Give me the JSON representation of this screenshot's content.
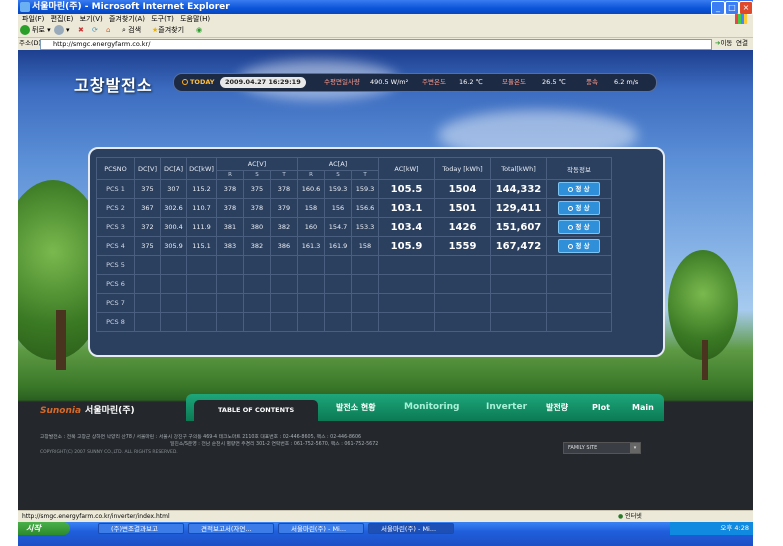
{
  "window": {
    "title": "서울마린(주) - Microsoft Internet Explorer",
    "min": "_",
    "max": "□",
    "close": "×"
  },
  "menu": [
    "파일(F)",
    "편집(E)",
    "보기(V)",
    "즐겨찾기(A)",
    "도구(T)",
    "도움말(H)"
  ],
  "toolbar": {
    "back": "뒤로",
    "search": "검색",
    "favorites": "즐겨찾기"
  },
  "address": {
    "label": "주소(D)",
    "url": "http://smgc.energyfarm.co.kr/",
    "go": "이동",
    "links": "연결 »"
  },
  "site": {
    "logo": "고창발전소",
    "today_label": "TODAY",
    "datetime": "2009.04.27 16:29:19",
    "irradiance_label": "수평면일사량",
    "irradiance_value": "490.5 W/m²",
    "ambient_label": "주변온도",
    "ambient_value": "16.2 ℃",
    "module_label": "모듈온도",
    "module_value": "26.5 ℃",
    "wind_label": "풍속",
    "wind_value": "6.2 m/s"
  },
  "table": {
    "headers": {
      "pcsno": "PCSNO",
      "dcv": "DC[V]",
      "dca": "DC[A]",
      "dckw": "DC[kW]",
      "acv": "AC[V]",
      "aca": "AC[A]",
      "ackw": "AC[kW]",
      "today": "Today [kWh]",
      "total": "Total[kWh]",
      "status": "작동정보",
      "r": "R",
      "s": "S",
      "t": "T"
    },
    "rows": [
      {
        "pcs": "PCS 1",
        "dcv": "375",
        "dca": "307",
        "dckw": "115.2",
        "acv_r": "378",
        "acv_s": "375",
        "acv_t": "378",
        "aca_r": "160.6",
        "aca_s": "159.3",
        "aca_t": "159.3",
        "ackw": "105.5",
        "today": "1504",
        "total": "144,332",
        "status": "정 상"
      },
      {
        "pcs": "PCS 2",
        "dcv": "367",
        "dca": "302.6",
        "dckw": "110.7",
        "acv_r": "378",
        "acv_s": "378",
        "acv_t": "379",
        "aca_r": "158",
        "aca_s": "156",
        "aca_t": "156.6",
        "ackw": "103.1",
        "today": "1501",
        "total": "129,411",
        "status": "정 상"
      },
      {
        "pcs": "PCS 3",
        "dcv": "372",
        "dca": "300.4",
        "dckw": "111.9",
        "acv_r": "381",
        "acv_s": "380",
        "acv_t": "382",
        "aca_r": "160",
        "aca_s": "154.7",
        "aca_t": "153.3",
        "ackw": "103.4",
        "today": "1426",
        "total": "151,607",
        "status": "정 상"
      },
      {
        "pcs": "PCS 4",
        "dcv": "375",
        "dca": "305.9",
        "dckw": "115.1",
        "acv_r": "383",
        "acv_s": "382",
        "acv_t": "386",
        "aca_r": "161.3",
        "aca_s": "161.9",
        "aca_t": "158",
        "ackw": "105.9",
        "today": "1559",
        "total": "167,472",
        "status": "정 상"
      },
      {
        "pcs": "PCS 5"
      },
      {
        "pcs": "PCS 6"
      },
      {
        "pcs": "PCS 7"
      },
      {
        "pcs": "PCS 8"
      }
    ]
  },
  "brand": {
    "mark": "Sunonia",
    "name": "서울마린(주)"
  },
  "nav": {
    "toc": "TABLE OF CONTENTS",
    "items": [
      "발전소 현황",
      "Monitoring",
      "Inverter",
      "발전량",
      "Plot",
      "Main"
    ]
  },
  "footer": {
    "line1": "고창발전소 : 전북 고창군 상하면 낙양리 산78 / 서울마린 : 서울시 강진구 구의동 469-4 테크노마트 2110호 대표번호 : 02-446-8605, 팩스 : 02-446-8606",
    "line2": "일진소/S운영 : 전남 순천시 별량면 주경리 301-2 연락번호 : 061-752-5670, 팩스 : 061-752-5672",
    "copyright": "COPYRIGHT(C) 2007 SUNNY CO.,LTD. ALL RIGHTS RESERVED.",
    "family_site": "FAMILY SITE"
  },
  "statusbar": {
    "url": "http://smgc.energyfarm.co.kr/inverter/index.html",
    "zone": "인터넷"
  },
  "taskbar": {
    "start": "시작",
    "tasks": [
      "(주)변조결과보고",
      "견적보고서(자연...",
      "서울마린(주) - Mi...",
      "서울마린(주) - Mi..."
    ],
    "time": "오후 4:28"
  }
}
